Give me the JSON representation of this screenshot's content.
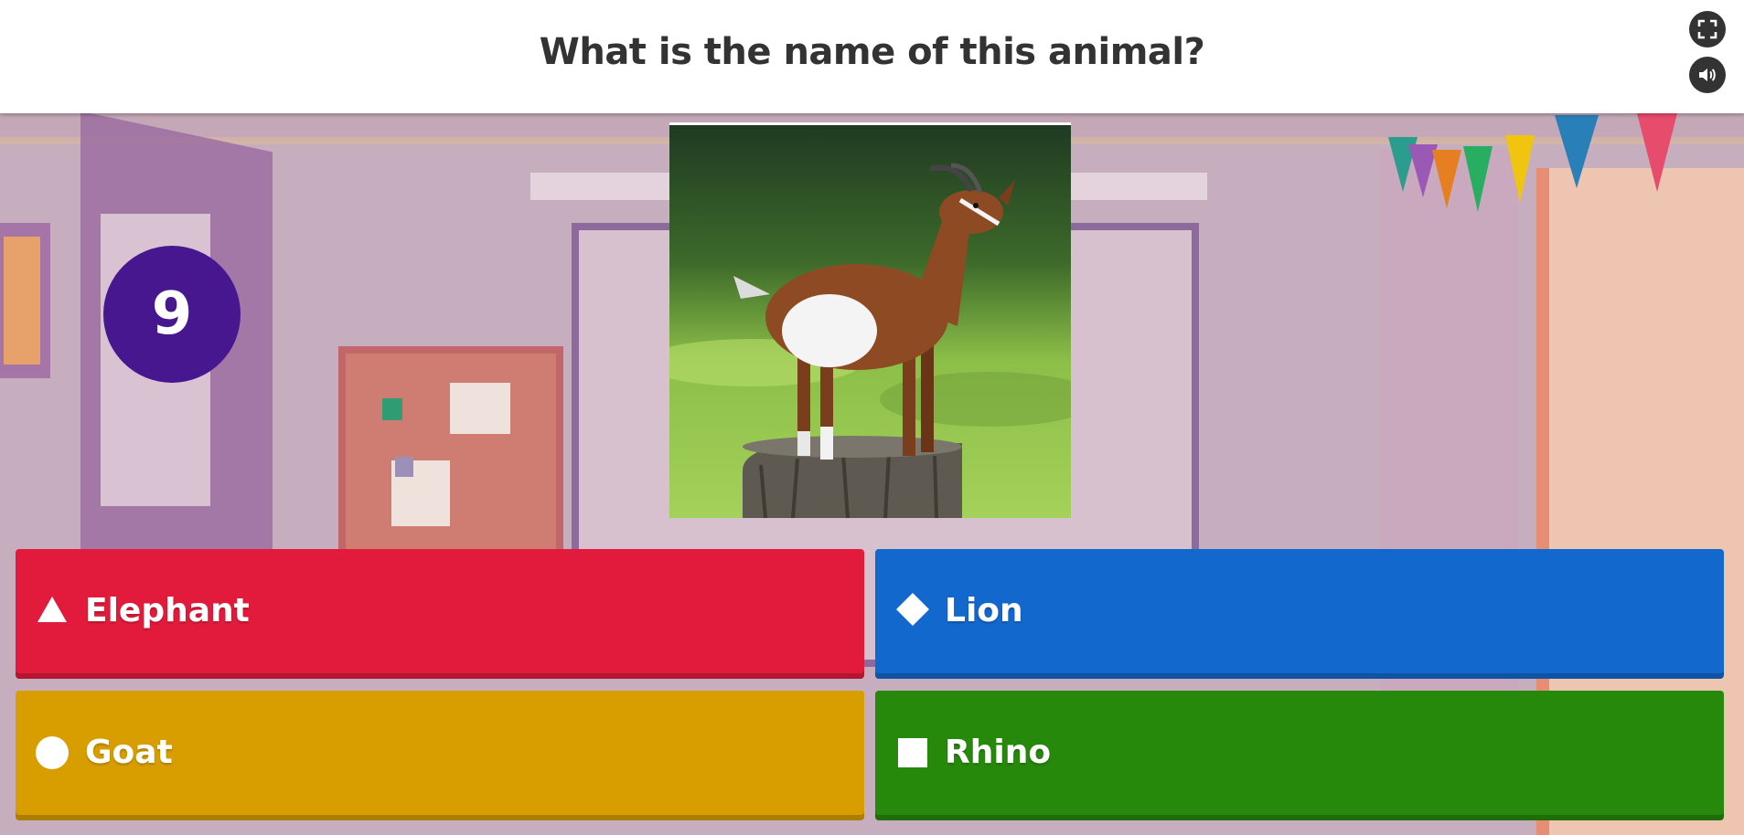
{
  "header": {
    "question": "What is the name of this animal?",
    "fullscreen_icon": "fullscreen-icon",
    "sound_icon": "speaker-icon"
  },
  "timer": {
    "seconds": "9"
  },
  "question_image": {
    "subject": "goat standing on a tree stump"
  },
  "answers": [
    {
      "label": "Elephant",
      "shape": "triangle-icon",
      "color": "#e21b3c"
    },
    {
      "label": "Lion",
      "shape": "diamond-icon",
      "color": "#1368ce"
    },
    {
      "label": "Goat",
      "shape": "circle-icon",
      "color": "#d89e00"
    },
    {
      "label": "Rhino",
      "shape": "square-icon",
      "color": "#26890c"
    }
  ],
  "colors": {
    "timer": "#46178f",
    "header_text": "#333333"
  }
}
